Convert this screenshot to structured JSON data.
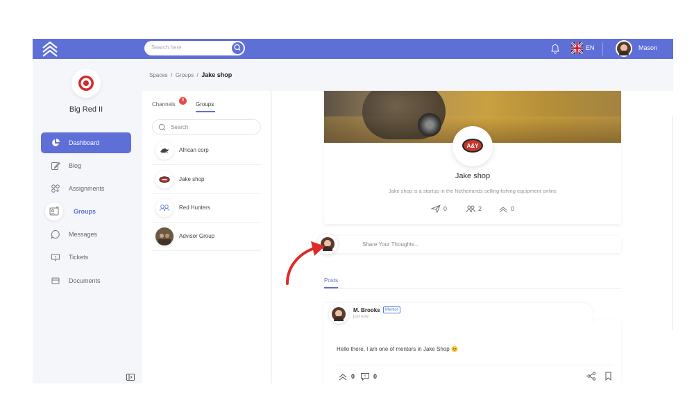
{
  "topbar": {
    "search_placeholder": "Search here",
    "language": "EN",
    "user_name": "Mason"
  },
  "sidebar": {
    "org_name": "Big Red II",
    "items": [
      {
        "label": "Dashboard",
        "icon": "pie-chart-icon",
        "active": true
      },
      {
        "label": "Blog",
        "icon": "edit-icon"
      },
      {
        "label": "Assignments",
        "icon": "assignments-icon"
      },
      {
        "label": "Groups",
        "icon": "groups-icon",
        "selected": true
      },
      {
        "label": "Messages",
        "icon": "message-icon"
      },
      {
        "label": "Tickets",
        "icon": "ticket-icon"
      },
      {
        "label": "Documents",
        "icon": "documents-icon"
      }
    ]
  },
  "breadcrumb": {
    "items": [
      "Spaces",
      "Groups"
    ],
    "current": "Jake shop"
  },
  "groups_panel": {
    "tabs": [
      "Channels",
      "Groups"
    ],
    "channels_badge": "9",
    "search_placeholder": "Search",
    "groups": [
      {
        "name": "African corp"
      },
      {
        "name": "Jake shop"
      },
      {
        "name": "Red Hunters"
      },
      {
        "name": "Advisor Group"
      }
    ]
  },
  "profile": {
    "name": "Jake shop",
    "description": "Jake shop is a startup in the Netherlands selling fishing equipment online",
    "logo_text": "A&Y",
    "stats": [
      {
        "icon": "send-icon",
        "value": "0"
      },
      {
        "icon": "members-icon",
        "value": "2"
      },
      {
        "icon": "level-icon",
        "value": "0"
      }
    ]
  },
  "share": {
    "placeholder": "Share Your Thoughts..."
  },
  "posts_tab": "Posts",
  "post": {
    "author": "M. Brooks",
    "badge": "Mentor",
    "time": "just now",
    "text": "Hello there, I am one of mentors in Jake Shop 😊",
    "likes": "0",
    "comments": "0"
  },
  "colors": {
    "accent": "#5e6fd8",
    "badge_red": "#e84a4a",
    "arrow_red": "#e02a2a"
  }
}
